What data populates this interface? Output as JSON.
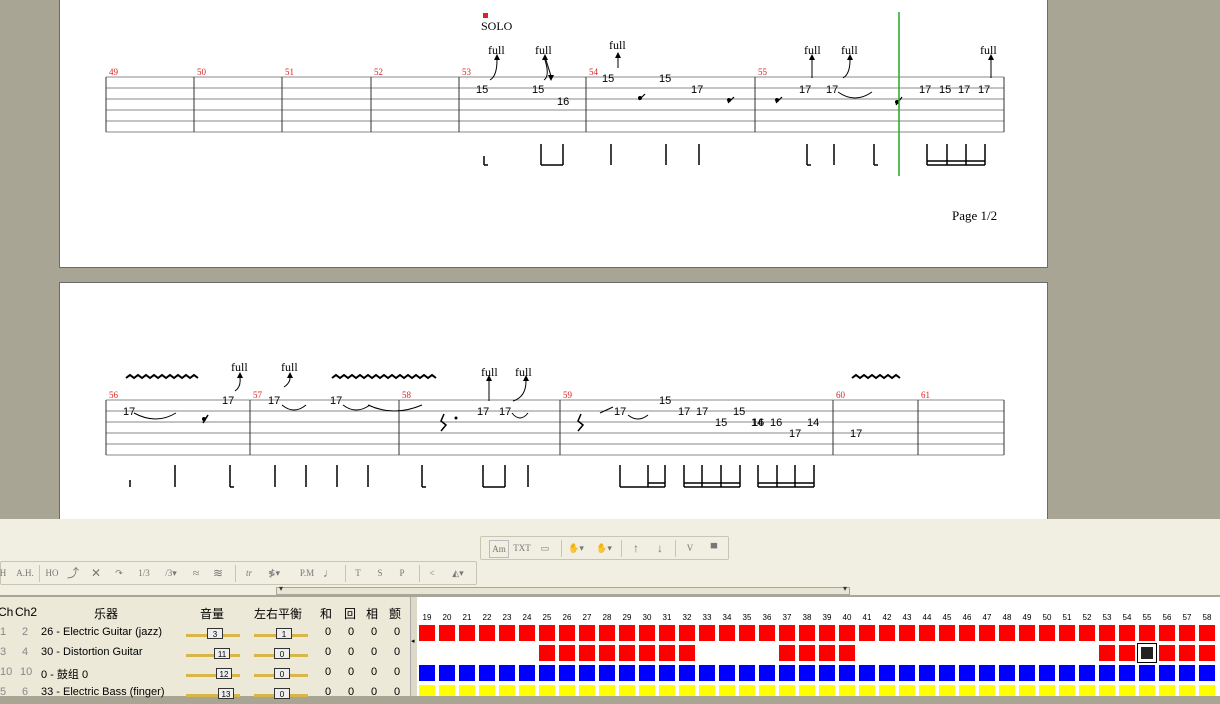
{
  "score": {
    "page1": {
      "measures": [
        "49",
        "50",
        "51",
        "52",
        "53",
        "54",
        "55"
      ],
      "solo_label": "SOLO",
      "page_label": "Page 1/2",
      "bend_label": "full",
      "frets": [
        "15",
        "15",
        "16",
        "15",
        "15",
        "17",
        "17",
        "17",
        "17",
        "15",
        "17",
        "17"
      ]
    },
    "page2": {
      "measures": [
        "56",
        "57",
        "58",
        "59",
        "60",
        "61"
      ],
      "bend_label": "full",
      "frets": [
        "17",
        "17",
        "17",
        "17",
        "17",
        "17",
        "17",
        "17",
        "15",
        "17",
        "15",
        "15",
        "16",
        "16",
        "14",
        "17",
        "14",
        "17"
      ]
    }
  },
  "toolbar": {
    "top_buttons": [
      "TXT"
    ],
    "bottom_buttons": [
      "H",
      "A.H.",
      "HO",
      "tr",
      "P.M",
      "T",
      "S",
      "P",
      "1/3"
    ]
  },
  "track_table": {
    "headers": {
      "ch": "Ch",
      "ch2": "Ch2",
      "instrument": "乐器",
      "volume": "音量",
      "pan": "左右平衡",
      "chorus": "和",
      "reverb": "回",
      "phaser": "相",
      "tremolo": "颤"
    },
    "rows": [
      {
        "ch": "1",
        "ch2": "2",
        "instrument": "26 - Electric Guitar (jazz)",
        "volume": "3",
        "pan": "1",
        "chorus": "0",
        "reverb": "0",
        "phaser": "0",
        "tremolo": "0",
        "color": "#ff0000"
      },
      {
        "ch": "3",
        "ch2": "4",
        "instrument": "30 - Distortion Guitar",
        "volume": "11",
        "pan": "0",
        "chorus": "0",
        "reverb": "0",
        "phaser": "0",
        "tremolo": "0",
        "color": "#ff0000"
      },
      {
        "ch": "10",
        "ch2": "10",
        "instrument": "0 - 鼓组 0",
        "volume": "12",
        "pan": "0",
        "chorus": "0",
        "reverb": "0",
        "phaser": "0",
        "tremolo": "0",
        "color": "#0000ff"
      },
      {
        "ch": "5",
        "ch2": "6",
        "instrument": "33 - Electric Bass (finger)",
        "volume": "13",
        "pan": "0",
        "chorus": "0",
        "reverb": "0",
        "phaser": "0",
        "tremolo": "0",
        "color": "#ffff00"
      }
    ],
    "measure_numbers": [
      "19",
      "20",
      "21",
      "22",
      "23",
      "24",
      "25",
      "26",
      "27",
      "28",
      "29",
      "30",
      "31",
      "32",
      "33",
      "34",
      "35",
      "36",
      "37",
      "38",
      "39",
      "40",
      "41",
      "42",
      "43",
      "44",
      "45",
      "46",
      "47",
      "48",
      "49",
      "50",
      "51",
      "52",
      "53",
      "54",
      "55",
      "56",
      "57",
      "58"
    ]
  }
}
